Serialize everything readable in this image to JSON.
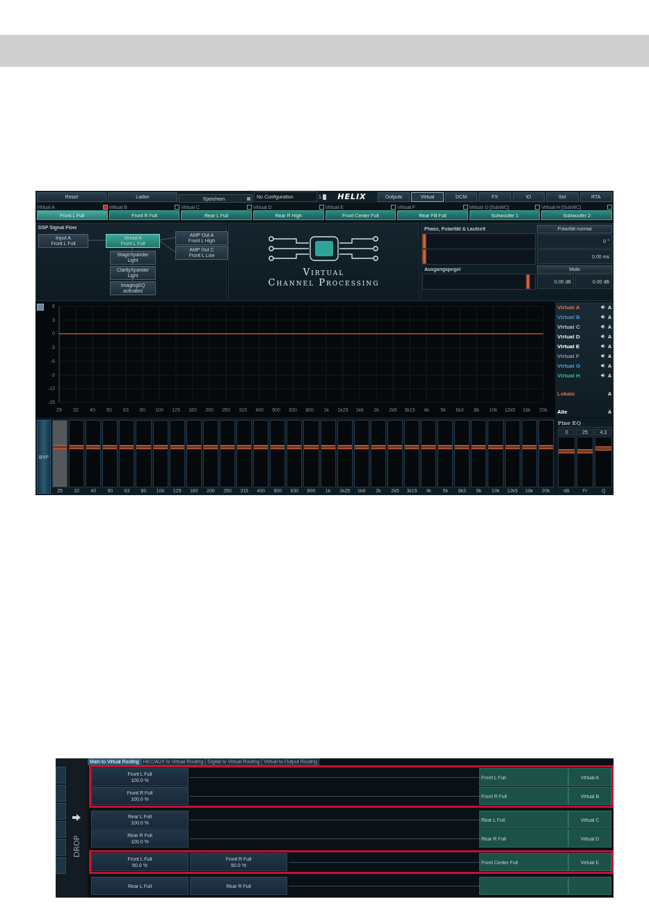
{
  "screen1": {
    "toolbar": {
      "buttons": [
        "Reset",
        "Laden"
      ],
      "preset": "Speichern",
      "configuration": "No Configuration",
      "config_number": "1",
      "logo": "HELIX"
    },
    "nav_tabs": [
      {
        "label": "Outputs",
        "selected": false
      },
      {
        "label": "Virtual",
        "selected": true
      },
      {
        "label": "DCM",
        "selected": false
      },
      {
        "label": "FX",
        "selected": false
      },
      {
        "label": "IO",
        "selected": false
      },
      {
        "label": "Set",
        "selected": false
      },
      {
        "label": "RTA",
        "selected": false
      }
    ],
    "channels": [
      {
        "label": "Virtual A",
        "checked": true,
        "button": "Front L Full",
        "selected": true
      },
      {
        "label": "Virtual B",
        "checked": false,
        "button": "Front R Full",
        "selected": false
      },
      {
        "label": "Virtual C",
        "checked": false,
        "button": "Rear L Full",
        "selected": false
      },
      {
        "label": "Virtual D",
        "checked": false,
        "button": "Rear R High",
        "selected": false
      },
      {
        "label": "Virtual E",
        "checked": false,
        "button": "Front Center Full",
        "selected": false
      },
      {
        "label": "Virtual F",
        "checked": false,
        "button": "Rear Fill Full",
        "selected": false
      },
      {
        "label": "Virtual G [SubWC]",
        "checked": false,
        "button": "Subwoofer 1",
        "selected": false
      },
      {
        "label": "Virtual H [SubWC]",
        "checked": false,
        "button": "Subwoofer 2",
        "selected": false
      }
    ],
    "signal_flow": {
      "title": "DSP Signal Flow",
      "nodes": [
        {
          "kind": "input",
          "lines": [
            "Input A",
            "Front L Full"
          ],
          "selected": false
        },
        {
          "kind": "virtual",
          "lines": [
            "Virtual A",
            "Front L Full"
          ],
          "selected": true
        },
        {
          "kind": "module",
          "lines": [
            "StageXpander",
            "Light"
          ],
          "selected": false
        },
        {
          "kind": "module",
          "lines": [
            "ClarityXpander",
            "Light"
          ],
          "selected": false
        },
        {
          "kind": "module",
          "lines": [
            "ImagingEQ",
            "activated"
          ],
          "selected": false
        },
        {
          "kind": "output",
          "lines": [
            "AMP Out A",
            "Front L High"
          ],
          "selected": false
        },
        {
          "kind": "output",
          "lines": [
            "AMP Out C",
            "Front L Low"
          ],
          "selected": false
        }
      ]
    },
    "processing_logo": {
      "line1": "Virtual",
      "line2": "Channel Processing"
    },
    "phase": {
      "title": "Phase, Polarität & Laufzeit",
      "polarity_button": "Polarität normal",
      "phase": {
        "level": 0.01,
        "reading": "0 °"
      },
      "delay": {
        "level": 0.01,
        "reading": "0.00 ms"
      },
      "level_title": "Ausgangspegel",
      "mute_button": "Mute",
      "output": {
        "level": 0.94,
        "reading": "0.00 dB",
        "reading_2": "0.00 dB"
      }
    },
    "chart_data": {
      "type": "line",
      "categories": [
        "25",
        "32",
        "40",
        "50",
        "63",
        "80",
        "100",
        "125",
        "160",
        "200",
        "250",
        "315",
        "400",
        "500",
        "630",
        "800",
        "1k",
        "1k25",
        "1k6",
        "2k",
        "2k5",
        "3k15",
        "4k",
        "5k",
        "6k3",
        "8k",
        "10k",
        "12k5",
        "16k",
        "20k"
      ],
      "series": [
        {
          "color": "#d9663a",
          "values": [
            0,
            0,
            0,
            0,
            0,
            0,
            0,
            0,
            0,
            0,
            0,
            0,
            0,
            0,
            0,
            0,
            0,
            0,
            0,
            0,
            0,
            0,
            0,
            0,
            0,
            0,
            0,
            0,
            0,
            0
          ]
        }
      ],
      "ylim": [
        -15,
        6
      ],
      "grid": true,
      "yticks": [
        6,
        3,
        0,
        -3,
        -6,
        -9,
        -12,
        -15
      ]
    },
    "legend": [
      {
        "kind": "channel",
        "label": "Virtual A",
        "color": "#e0703a",
        "badge": "A"
      },
      {
        "kind": "channel",
        "label": "Virtual B",
        "color": "#4f8fc0",
        "badge": "A"
      },
      {
        "kind": "channel",
        "label": "Virtual C",
        "color": "#b8c4cc",
        "badge": "A"
      },
      {
        "kind": "channel",
        "label": "Virtual D",
        "color": "#dfe6ea",
        "badge": "A"
      },
      {
        "kind": "channel",
        "label": "Virtual E",
        "color": "#ffffff",
        "badge": "A"
      },
      {
        "kind": "channel",
        "label": "Virtual F",
        "color": "#8a96a0",
        "badge": "A"
      },
      {
        "kind": "channel",
        "label": "Virtual G",
        "color": "#3fa6d8",
        "badge": "A"
      },
      {
        "kind": "channel",
        "label": "Virtual H",
        "color": "#2fbf8f",
        "badge": "A"
      },
      {
        "kind": "group",
        "label": "Lokale",
        "color": "#e0703a",
        "badge": "A"
      },
      {
        "kind": "group",
        "label": "Alle",
        "color": "#ffffff",
        "badge": "A"
      }
    ],
    "eq": {
      "bypass": "BYP",
      "faders": [
        {
          "label": "25",
          "level": 0.6,
          "selected": true
        },
        {
          "label": "32",
          "level": 0.6,
          "selected": false
        },
        {
          "label": "40",
          "level": 0.6,
          "selected": false
        },
        {
          "label": "50",
          "level": 0.6,
          "selected": false
        },
        {
          "label": "63",
          "level": 0.6,
          "selected": false
        },
        {
          "label": "80",
          "level": 0.6,
          "selected": false
        },
        {
          "label": "100",
          "level": 0.6,
          "selected": false
        },
        {
          "label": "125",
          "level": 0.6,
          "selected": false
        },
        {
          "label": "160",
          "level": 0.6,
          "selected": false
        },
        {
          "label": "200",
          "level": 0.6,
          "selected": false
        },
        {
          "label": "250",
          "level": 0.6,
          "selected": false
        },
        {
          "label": "315",
          "level": 0.6,
          "selected": false
        },
        {
          "label": "400",
          "level": 0.6,
          "selected": false
        },
        {
          "label": "500",
          "level": 0.6,
          "selected": false
        },
        {
          "label": "630",
          "level": 0.6,
          "selected": false
        },
        {
          "label": "800",
          "level": 0.6,
          "selected": false
        },
        {
          "label": "1k",
          "level": 0.6,
          "selected": false
        },
        {
          "label": "1k25",
          "level": 0.6,
          "selected": false
        },
        {
          "label": "1k6",
          "level": 0.6,
          "selected": false
        },
        {
          "label": "2k",
          "level": 0.6,
          "selected": false
        },
        {
          "label": "2k5",
          "level": 0.6,
          "selected": false
        },
        {
          "label": "3k15",
          "level": 0.6,
          "selected": false
        },
        {
          "label": "4k",
          "level": 0.6,
          "selected": false
        },
        {
          "label": "5k",
          "level": 0.6,
          "selected": false
        },
        {
          "label": "6k3",
          "level": 0.6,
          "selected": false
        },
        {
          "label": "8k",
          "level": 0.6,
          "selected": false
        },
        {
          "label": "10k",
          "level": 0.6,
          "selected": false
        },
        {
          "label": "12k5",
          "level": 0.6,
          "selected": false
        },
        {
          "label": "16k",
          "level": 0.6,
          "selected": false
        },
        {
          "label": "20k",
          "level": 0.6,
          "selected": false
        }
      ]
    },
    "fine_eq": {
      "title": "Fine EQ",
      "faders": [
        {
          "value": "0",
          "label": "dB",
          "level": 0.72
        },
        {
          "value": "25",
          "label": "Fr",
          "level": 0.72
        },
        {
          "value": "4.3",
          "label": "Q",
          "level": 0.78
        }
      ]
    }
  },
  "screen2": {
    "tabs": [
      {
        "label": "Main to Virtual Routing",
        "selected": true
      },
      {
        "label": "HEC/AUX to Virtual Routing",
        "selected": false
      },
      {
        "label": "Digital to Virtual Routing",
        "selected": false
      },
      {
        "label": "Virtual to Output Routing",
        "selected": false
      }
    ],
    "side_label": "DROP",
    "rows": [
      {
        "sources": [
          {
            "name": "Front L Full",
            "share": "100.0 %"
          }
        ],
        "target": "Front L Full",
        "virtual": "Virtual A",
        "highlighted": true
      },
      {
        "sources": [
          {
            "name": "Front R Full",
            "share": "100.0 %"
          }
        ],
        "target": "Front R Full",
        "virtual": "Virtual B",
        "highlighted": true
      },
      {
        "sources": [
          {
            "name": "Rear L Full",
            "share": "100.0 %"
          }
        ],
        "target": "Rear L Full",
        "virtual": "Virtual C",
        "highlighted": false
      },
      {
        "sources": [
          {
            "name": "Rear R Full",
            "share": "100.0 %"
          }
        ],
        "target": "Rear R Full",
        "virtual": "Virtual D",
        "highlighted": false
      },
      {
        "sources": [
          {
            "name": "Front L Full",
            "share": "50.0 %"
          },
          {
            "name": "Front R Full",
            "share": "50.0 %"
          }
        ],
        "target": "Front Center Full",
        "virtual": "Virtual E",
        "highlighted": true
      },
      {
        "sources": [
          {
            "name": "Rear L Full"
          },
          {
            "name": "Rear R Full"
          }
        ],
        "highlighted": false
      }
    ]
  }
}
